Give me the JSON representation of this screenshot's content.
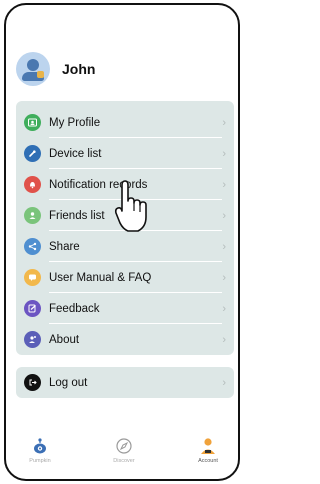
{
  "user": {
    "name": "John"
  },
  "menu": [
    {
      "label": "My Profile",
      "icon": "profile-card-icon",
      "color": "#3fae5c"
    },
    {
      "label": "Device list",
      "icon": "device-icon",
      "color": "#2f6fb5"
    },
    {
      "label": "Notification records",
      "icon": "bell-icon",
      "color": "#e0524a"
    },
    {
      "label": "Friends list",
      "icon": "person-icon",
      "color": "#7ac47b"
    },
    {
      "label": "Share",
      "icon": "share-icon",
      "color": "#4f8fd0"
    },
    {
      "label": "User Manual & FAQ",
      "icon": "chat-bubble-icon",
      "color": "#f2b84b"
    },
    {
      "label": "Feedback",
      "icon": "edit-icon",
      "color": "#6c55c2"
    },
    {
      "label": "About",
      "icon": "info-person-icon",
      "color": "#5b5fb8"
    }
  ],
  "logout": {
    "label": "Log out",
    "icon": "logout-icon",
    "color": "#111111"
  },
  "tabs": [
    {
      "label": "Pumpkin",
      "icon": "robot-icon",
      "active": false
    },
    {
      "label": "Discover",
      "icon": "compass-icon",
      "active": false
    },
    {
      "label": "Account",
      "icon": "account-icon",
      "active": true
    }
  ]
}
